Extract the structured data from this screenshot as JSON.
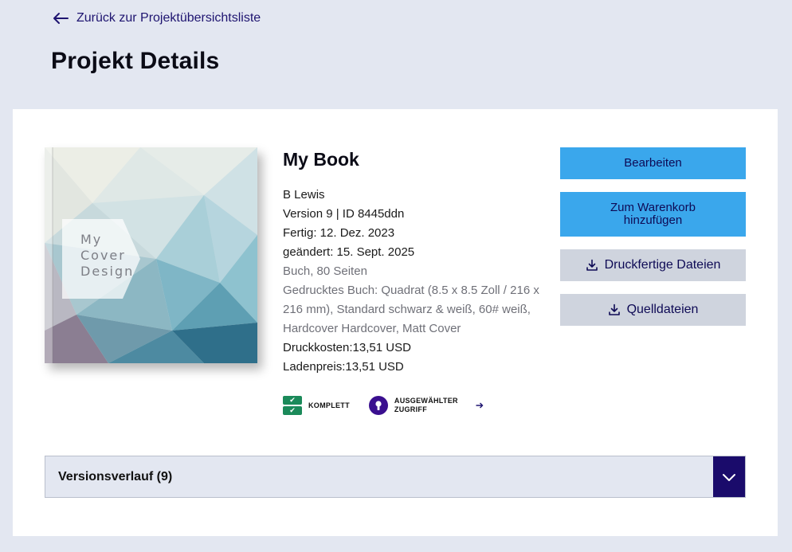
{
  "nav": {
    "back_label": "Zurück zur Projektübersichtsliste"
  },
  "page": {
    "title": "Projekt Details"
  },
  "cover": {
    "text_lines": [
      "My",
      "Cover",
      "Design"
    ]
  },
  "book": {
    "title": "My Book",
    "author": "B Lewis",
    "version": "Version 9 | ID 8445ddn",
    "finished": "Fertig: 12. Dez. 2023",
    "modified": "geändert: 15. Sept. 2025",
    "format": "Buch, 80 Seiten",
    "print_spec": "Gedrucktes Buch: Quadrat (8.5 x 8.5 Zoll / 216 x 216 mm), Standard schwarz & weiß, 60# weiß, Hardcover Hardcover, Matt Cover",
    "print_cost": "Druckkosten:13,51 USD",
    "retail_price": "Ladenpreis:13,51 USD"
  },
  "badges": {
    "complete": "KOMPLETT",
    "access_line1": "AUSGEWÄHLTER",
    "access_line2": "ZUGRIFF"
  },
  "actions": {
    "edit": "Bearbeiten",
    "cart_line1": "Zum Warenkorb",
    "cart_line2": "hinzufügen",
    "print_files": "Druckfertige Dateien",
    "source_files": "Quelldateien"
  },
  "versions": {
    "label": "Versionsverlauf (9)"
  },
  "icons": {
    "back": "arrow-left-icon",
    "download": "download-icon",
    "check": "check-icon",
    "key": "keyhole-icon",
    "arrow_right": "arrow-right-icon",
    "chevron": "chevron-down-icon"
  },
  "colors": {
    "page_bg": "#e3e7f1",
    "primary_button": "#3aa7ec",
    "secondary_button": "#cfd4de",
    "link": "#1e1470",
    "complete_green": "#1b8a5a",
    "access_purple": "#3a0f8f",
    "toggle_dark": "#1a0b6b"
  }
}
